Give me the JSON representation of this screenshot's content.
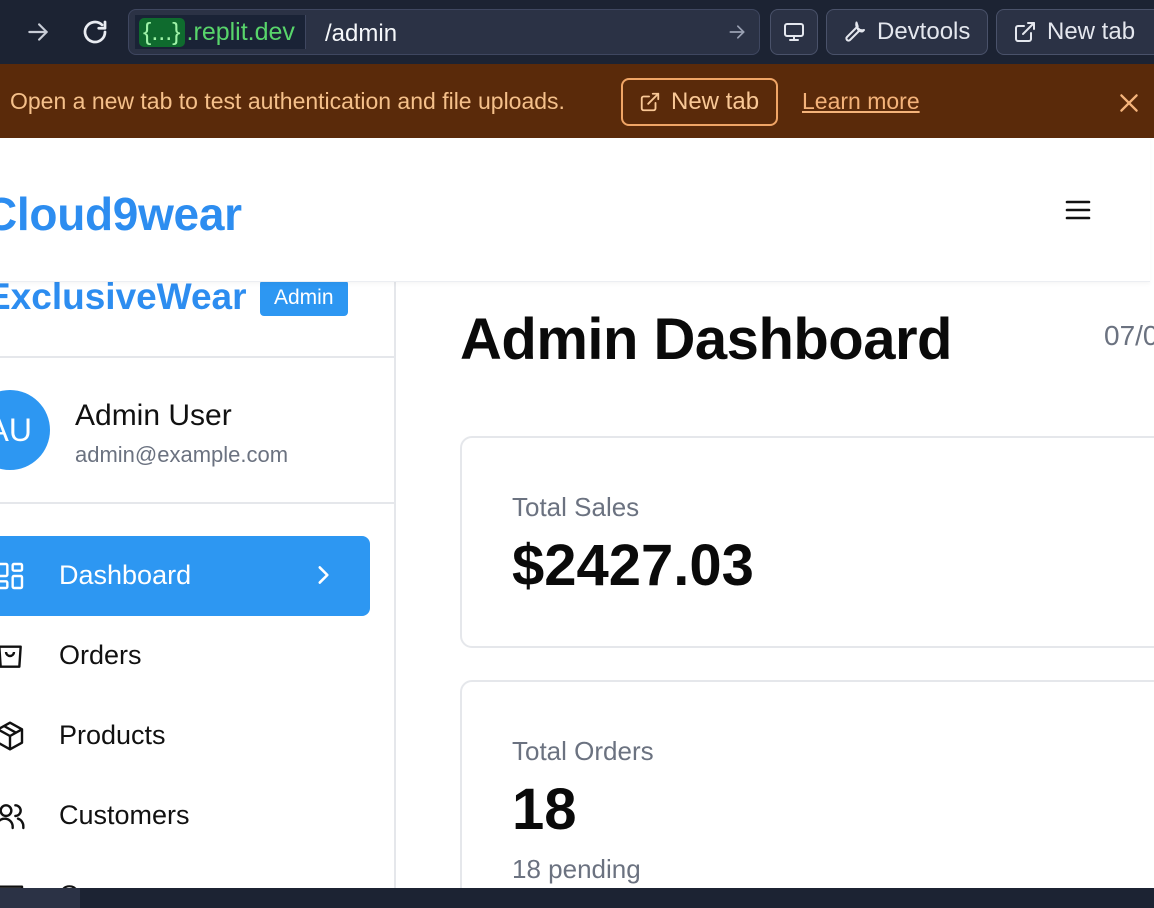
{
  "browser": {
    "domain_prefix": "{...}",
    "domain_suffix": ".replit.dev",
    "path": "/admin",
    "devtools_label": "Devtools",
    "new_tab_label": "New tab"
  },
  "banner": {
    "message": "Open a new tab to test authentication and file uploads.",
    "button_label": "New tab",
    "link_label": "Learn more"
  },
  "header": {
    "brand": "Cloud9wear"
  },
  "sidebar": {
    "brand": "ExclusiveWear",
    "badge": "Admin",
    "user": {
      "initials": "AU",
      "name": "Admin User",
      "email": "admin@example.com"
    },
    "items": [
      {
        "label": "Dashboard",
        "icon": "dashboard-icon",
        "active": true
      },
      {
        "label": "Orders",
        "icon": "shopping-bag-icon",
        "active": false
      },
      {
        "label": "Products",
        "icon": "package-icon",
        "active": false
      },
      {
        "label": "Customers",
        "icon": "users-icon",
        "active": false
      },
      {
        "label": "Coupons",
        "icon": "coupon-icon",
        "active": false
      }
    ]
  },
  "main": {
    "title": "Admin Dashboard",
    "date": "07/0",
    "cards": [
      {
        "label": "Total Sales",
        "value": "$2427.03",
        "sub": ""
      },
      {
        "label": "Total Orders",
        "value": "18",
        "sub": "18 pending"
      }
    ]
  },
  "colors": {
    "accent": "#2d97f2",
    "brand_text": "#2d8df0",
    "banner_bg": "#5a2a0a",
    "browser_bg": "#1c2333"
  }
}
